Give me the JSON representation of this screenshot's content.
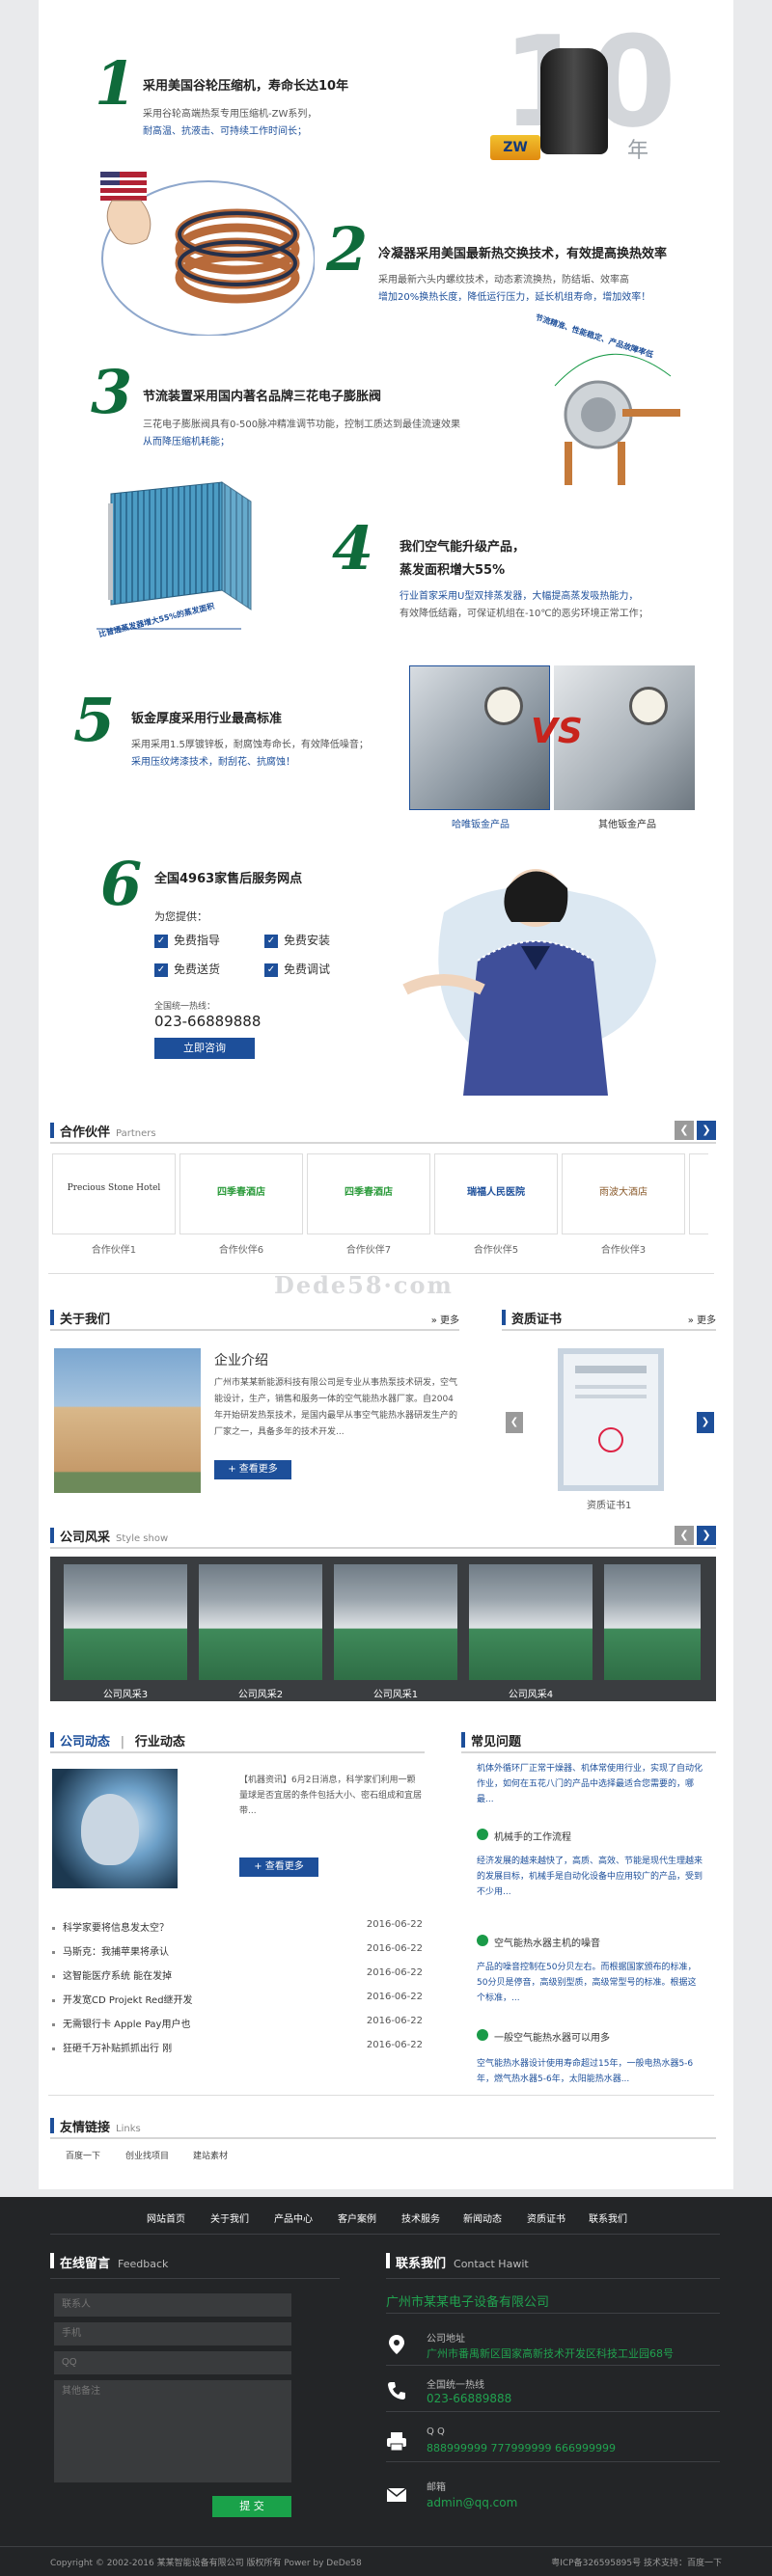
{
  "features": [
    {
      "num": "1",
      "title": "采用美国谷轮压缩机，寿命长达10年",
      "line1": "采用谷轮高端热泵专用压缩机-ZW系列，",
      "line2": "耐高温、抗液击、可持续工作时间长；"
    },
    {
      "num": "2",
      "title": "冷凝器采用美国最新热交换技术，有效提高换热效率",
      "line1": "采用最新六头内螺纹技术，动态紊流换热，防结垢、效率高",
      "line2": "增加20%换热长度，降低运行压力，延长机组寿命，增加效率！"
    },
    {
      "num": "3",
      "title": "节流装置采用国内著名品牌三花电子膨胀阀",
      "line1": "三花电子膨胀阀具有0-500脉冲精准调节功能，控制工质达到最佳流速效果",
      "line2": "从而降压缩机耗能；"
    },
    {
      "num": "4",
      "title": "我们空气能升级产品，",
      "title2": "蒸发面积增大55%",
      "line1": "行业首家采用U型双排蒸发器，大幅提高蒸发吸热能力，",
      "line2": "有效降低结霜，可保证机组在-10℃的恶劣环境正常工作；"
    },
    {
      "num": "5",
      "title": "钣金厚度采用行业最高标准",
      "line1": "采用采用1.5厚镀锌板，耐腐蚀寿命长，有效降低噪音；",
      "line2": "采用压纹烤漆技术，耐刮花、抗腐蚀！"
    },
    {
      "num": "6",
      "title": "全国4963家售后服务网点"
    }
  ],
  "badges": {
    "years": "10",
    "year_char": "年",
    "zw": "ZW",
    "valve_arc": "节流精准、性能稳定、产品故障率低",
    "evap_arc": "比普通蒸发器增大55%的蒸发面积",
    "vs": "VS",
    "cmp_left": "哈唯钣金产品",
    "cmp_right": "其他钣金产品"
  },
  "service": {
    "provide": "为您提供：",
    "items": [
      "免费指导",
      "免费安装",
      "免费送货",
      "免费调试"
    ],
    "hotline_label": "全国统一热线：",
    "hotline": "023-66889888",
    "consult_btn": "立即咨询"
  },
  "partners": {
    "title": "合作伙伴",
    "en": "Partners",
    "logos": [
      "Precious Stone Hotel",
      "四季春酒店",
      "四季春酒店",
      "瑞福人民医院",
      "雨波大酒店"
    ],
    "captions": [
      "合作伙伴1",
      "合作伙伴6",
      "合作伙伴7",
      "合作伙伴5",
      "合作伙伴3"
    ]
  },
  "watermark": "Dede58·com",
  "about": {
    "title": "关于我们",
    "more": "» 更多",
    "heading": "企业介绍",
    "text": "广州市某某新能源科技有限公司是专业从事热泵技术研发，空气能设计，生产，销售和服务一体的空气能热水器厂家。自2004年开始研发热泵技术，是国内最早从事空气能热水器研发生产的厂家之一，具备多年的技术开发...",
    "btn": "+ 查看更多"
  },
  "cert": {
    "title": "资质证书",
    "more": "» 更多",
    "caption": "资质证书1"
  },
  "style": {
    "title": "公司风采",
    "en": "Style show",
    "captions": [
      "公司风采3",
      "公司风采2",
      "公司风采1",
      "公司风采4"
    ]
  },
  "news": {
    "tab1": "公司动态",
    "tab2": "行业动态",
    "featured": "【机器资讯】6月2日消息，科学家们利用一颗量球是否宜居的条件包括大小、密石组成和宜居带...",
    "btn": "+ 查看更多",
    "items": [
      {
        "t": "科学家要将信息发太空？",
        "d": "2016-06-22"
      },
      {
        "t": "马斯克：我捕苹果将承认",
        "d": "2016-06-22"
      },
      {
        "t": "这智能医疗系统 能在发掉",
        "d": "2016-06-22"
      },
      {
        "t": "开发宽CD Projekt Red继开发",
        "d": "2016-06-22"
      },
      {
        "t": "无需银行卡 Apple Pay用户也",
        "d": "2016-06-22"
      },
      {
        "t": "狂砸千万补贴抓抓出行 刚",
        "d": "2016-06-22"
      }
    ]
  },
  "faq": {
    "title": "常见问题",
    "top_answer": "机体外循环厂正常干燥器、机体常使用行业，实现了自动化作业，如何在五花八门的产品中选择最适合您需要的，哪最...",
    "items": [
      {
        "q": "机械手的工作流程",
        "a": "经济发展的越来越快了，高质、高效、节能是现代生理越来的发展目标，机械手是自动化设备中应用较广的产品，受到不少用..."
      },
      {
        "q": "空气能热水器主机的噪音",
        "a": "产品的噪音控制在50分贝左右。而根据国家颁布的标准，50分贝是停音，高级别型质，高级常型号的标准。根据这个标准，..."
      },
      {
        "q": "一般空气能热水器可以用多",
        "a": "空气能热水器设计使用寿命超过15年，一般电热水器5-6年，燃气热水器5-6年，太阳能热水器..."
      }
    ]
  },
  "links": {
    "title": "友情链接",
    "en": "Links",
    "items": [
      "百度一下",
      "创业找项目",
      "建站素材"
    ]
  },
  "footer_nav": [
    "网站首页",
    "关于我们",
    "产品中心",
    "客户案例",
    "技术服务",
    "新闻动态",
    "资质证书",
    "联系我们"
  ],
  "feedback": {
    "title": "在线留言",
    "en": "Feedback",
    "name_ph": "联系人",
    "phone_ph": "手机",
    "qq_ph": "QQ",
    "note_ph": "其他备注",
    "submit": "提 交"
  },
  "contact": {
    "title": "联系我们",
    "en": "Contact Hawit",
    "company": "广州市某某电子设备有限公司",
    "addr_label": "公司地址",
    "addr": "广州市番禺新区国家高新技术开发区科技工业园68号",
    "tel_label": "全国统一热线",
    "tel": "023-66889888",
    "qq_label": "Q Q",
    "qq": "888999999   777999999   666999999",
    "mail_label": "邮箱",
    "mail": "admin@qq.com"
  },
  "copyright": "Copyright © 2002-2016 某某智能设备有限公司 版权所有 Power by DeDe58",
  "icp": "粤ICP备326595895号 技术支持：百度一下"
}
